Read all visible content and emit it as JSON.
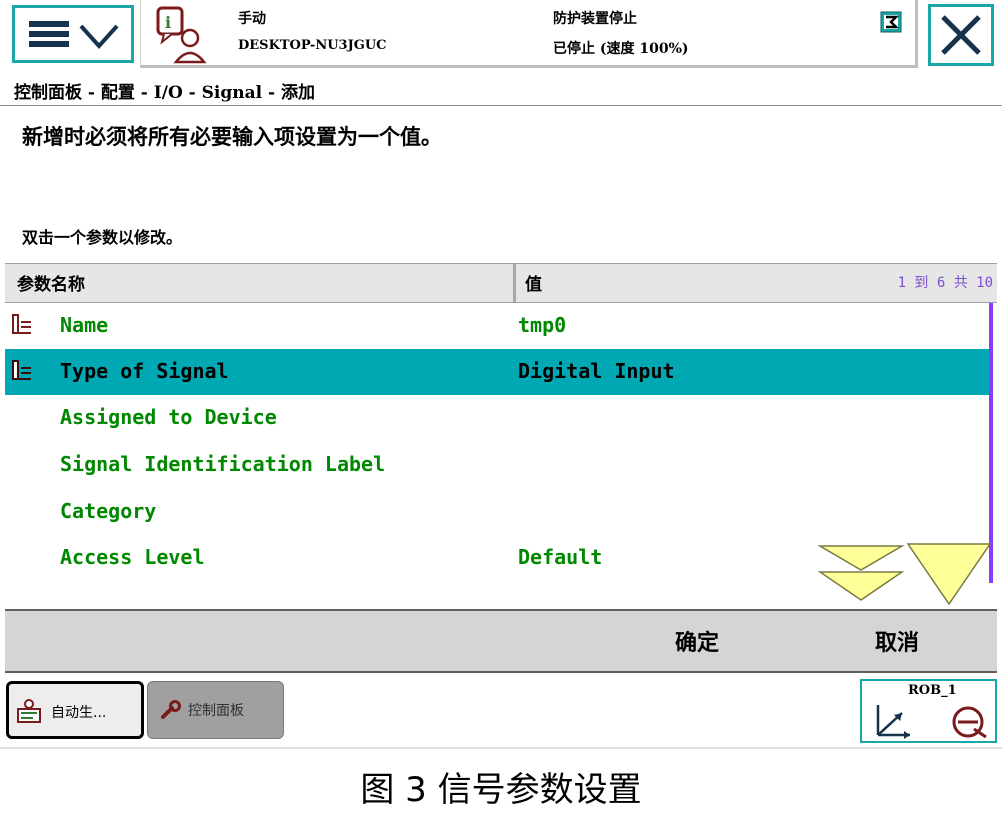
{
  "header": {
    "mode": "手动",
    "host": "DESKTOP-NU3JGUC",
    "guard_status": "防护装置停止",
    "run_status": "已停止 (速度 100%)"
  },
  "breadcrumb": "控制面板 - 配置 - I/O - Signal - 添加",
  "instructions": {
    "line1": "新增时必须将所有必要输入项设置为一个值。",
    "line2": "双击一个参数以修改。"
  },
  "table": {
    "col_name": "参数名称",
    "col_value": "值",
    "count": "1 到 6 共 10",
    "rows": [
      {
        "name": "Name",
        "value": "tmp0",
        "icon": "param-icon",
        "selected": false
      },
      {
        "name": "Type of Signal",
        "value": "Digital Input",
        "icon": "param-icon",
        "selected": true
      },
      {
        "name": "Assigned to Device",
        "value": "",
        "icon": "",
        "selected": false
      },
      {
        "name": "Signal Identification Label",
        "value": "",
        "icon": "",
        "selected": false
      },
      {
        "name": "Category",
        "value": "",
        "icon": "",
        "selected": false
      },
      {
        "name": "Access Level",
        "value": "Default",
        "icon": "",
        "selected": false
      }
    ]
  },
  "commands": {
    "ok": "确定",
    "cancel": "取消"
  },
  "taskbar": {
    "task1": "自动生...",
    "task2": "控制面板",
    "robot": "ROB_1"
  },
  "caption": "图 3    信号参数设置",
  "colors": {
    "accent": "#19a7a7",
    "selected_row": "#00a8b4",
    "param_text": "#008800",
    "scrollbar": "#8a3cff"
  }
}
